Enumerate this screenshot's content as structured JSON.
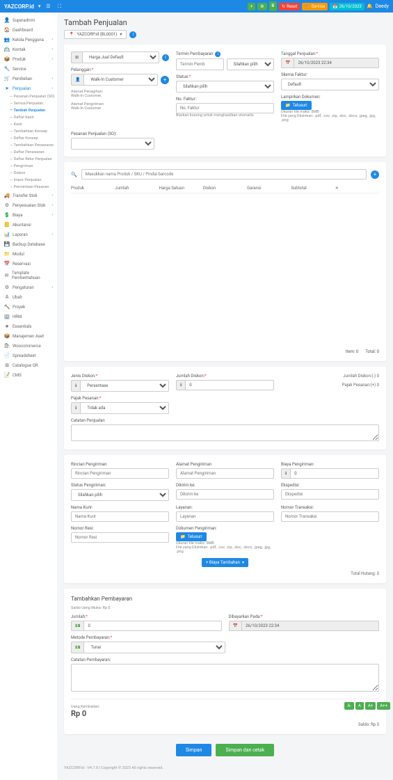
{
  "header": {
    "brand": "YAZCORP.id",
    "brand_sub": "▾",
    "reset": "Reset",
    "service": "Service",
    "date": "26/10/2023",
    "user": "Deedy"
  },
  "sidebar": {
    "items": [
      {
        "icon": "👤",
        "label": "Superadmin"
      },
      {
        "icon": "🏠",
        "label": "Dashboard"
      },
      {
        "icon": "👥",
        "label": "Kelola Pengguna",
        "chev": "‹"
      },
      {
        "icon": "📇",
        "label": "Kontak",
        "chev": "‹"
      },
      {
        "icon": "📦",
        "label": "Produk",
        "chev": "‹"
      },
      {
        "icon": "🔧",
        "label": "Service"
      },
      {
        "icon": "🛒",
        "label": "Pembelian",
        "chev": "‹"
      },
      {
        "icon": "➤",
        "label": "Penjualan",
        "chev": "‹",
        "active": true
      },
      {
        "icon": "🚚",
        "label": "Transfer Stok",
        "chev": "‹"
      },
      {
        "icon": "⚙",
        "label": "Penyesuaian Stok",
        "chev": "‹"
      },
      {
        "icon": "💲",
        "label": "Biaya",
        "chev": "‹"
      },
      {
        "icon": "📒",
        "label": "Akuntansi"
      },
      {
        "icon": "📊",
        "label": "Laporan",
        "chev": "‹"
      },
      {
        "icon": "💾",
        "label": "Backup Database"
      },
      {
        "icon": "📁",
        "label": "Modul"
      },
      {
        "icon": "📅",
        "label": "Reservasi"
      },
      {
        "icon": "✉",
        "label": "Template Pemberitahuan"
      },
      {
        "icon": "⚙",
        "label": "Pengaturan",
        "chev": "‹"
      },
      {
        "icon": "A",
        "label": "Ubah"
      },
      {
        "icon": "🔨",
        "label": "Proyek"
      },
      {
        "icon": "🏢",
        "label": "HRM"
      },
      {
        "icon": "★",
        "label": "Essentials"
      },
      {
        "icon": "📦",
        "label": "Manajemen Aset"
      },
      {
        "icon": "🛍",
        "label": "Woocommerce"
      },
      {
        "icon": "📄",
        "label": "Spreadsheet"
      },
      {
        "icon": "⊞",
        "label": "Catalogue QR"
      },
      {
        "icon": "📝",
        "label": "CMS"
      }
    ],
    "subs": [
      "Pesanan Penjualan (SO)",
      "Semua Penjualan",
      "Tambah Penjualan",
      "Daftar Kasir",
      "Kasir",
      "Tambahkan Konsep",
      "Daftar Konsep",
      "Tambahkan Penawaran",
      "Daftar Penawaran",
      "Daftar Retur Penjualan",
      "Pengiriman",
      "Diskon",
      "Impor Penjualan",
      "Permintaan Pesanan"
    ]
  },
  "page": {
    "title": "Tambah Penjualan"
  },
  "location": {
    "value": "YAZCORP.id (BL0001)"
  },
  "price_scheme": {
    "label": "Harga Jual Default"
  },
  "customer": {
    "label": "Pelanggan:",
    "value": "Walk-In Customer",
    "billing_label": "Alamat Penagihan:",
    "billing_value": "Walk-In Customer,",
    "shipping_label": "Alamat Pengiriman:",
    "shipping_value": "Walk-In Customer"
  },
  "so": {
    "label": "Pesanan Penjualan (SO):"
  },
  "payment_term": {
    "label": "Termin Pembayaran:",
    "placeholder1": "Termin Pemb",
    "value2": "Silahkan pilih"
  },
  "status": {
    "label": "Status:",
    "value": "Silahkan pilih"
  },
  "invoice": {
    "no_label": "No. Faktur:",
    "no_placeholder": "No. Faktur",
    "note": "Biarkan kosong untuk menghasilkan otomatis"
  },
  "sale_date": {
    "label": "Tanggal Penjualan:",
    "value": "26/10/2023 22:34"
  },
  "invoice_scheme": {
    "label": "Skema Faktur:",
    "value": "Default"
  },
  "attach": {
    "label": "Lampirkan Dokumen:",
    "btn": "Telusuri",
    "max": "Ukuran file maks: 5MB",
    "types": "File yang Diizinkan: .pdf, .csv, .zip, .doc, .docx, .jpeg, .jpg, .png"
  },
  "product_search": {
    "placeholder": "Masukkan nama Produk / SKU / Pindai barcode"
  },
  "table": {
    "headers": [
      "Produk",
      "Jumlah",
      "Harga Satuan",
      "Diskon",
      "Garansi",
      "Subtotal",
      "✕"
    ],
    "items_label": "Item:",
    "items_val": "0",
    "total_label": "Total:",
    "total_val": "0"
  },
  "discount": {
    "type_label": "Jenis Diskon:",
    "type_value": "Persentase",
    "amount_label": "Jumlah Diskon:",
    "amount_value": "0",
    "summary": "Jumlah Diskon:(-) 0"
  },
  "tax": {
    "label": "Pajak Pesanan:",
    "value": "Tidak ada",
    "summary": "Pajak Pesanan:(+) 0"
  },
  "sale_note": {
    "label": "Catatan Penjualan"
  },
  "shipping": {
    "detail_label": "Rincian Pengiriman",
    "detail_placeholder": "Rincian Pengiriman",
    "address_label": "Alamat Pengiriman",
    "address_placeholder": "Alamat Pengiriman",
    "cost_label": "Biaya Pengiriman:",
    "cost_value": "0",
    "status_label": "Status Pengiriman:",
    "status_value": "Silahkan pilih",
    "sendto_label": "Dikirim ke:",
    "sendto_placeholder": "Dikirim ke",
    "expedition_label": "Ekspedisi:",
    "expedition_placeholder": "Ekspedisi",
    "courier_label": "Nama Kurir:",
    "courier_placeholder": "Nama Kurir",
    "service_label": "Layanan:",
    "service_placeholder": "Layanan",
    "trx_label": "Nomor Transaksi:",
    "trx_placeholder": "Nomor Transaksi",
    "resi_label": "Nomor Resi:",
    "resi_placeholder": "Nomor Resi",
    "doc_label": "Dokumen Pengiriman:",
    "doc_btn": "Telusuri",
    "doc_max": "Ukuran file maks: 5MB",
    "doc_types": "File yang Diizinkan: .pdf, .csv, .zip, .doc, .docx, .jpeg, .jpg, .png",
    "extra_btn": "+ Biaya Tambahan ",
    "due_label": "Total Hutang:",
    "due_value": "0"
  },
  "payment": {
    "title": "Tambahkan Pembayaran",
    "advance": "Saldo Uang Muka: Rp 0",
    "amount_label": "Jumlah:",
    "amount_value": "0",
    "paid_label": "Dibayarkan Pada:",
    "paid_value": "26/10/2023 22:34",
    "method_label": "Metode Pembayaran:",
    "method_value": "Tunai",
    "note_label": "Catatan Pembayaran:",
    "change_label": "Uang Kembalian:",
    "change_value": "Rp 0",
    "balance": "Saldo: Rp 0"
  },
  "actions": {
    "save": "Simpan",
    "save_print": "Simpan dan cetak"
  },
  "footer": {
    "copyright": "YAZCORP.id - V4.7.8 | Copyright © 2023 All rights reserved."
  },
  "acc": [
    "A-",
    "A",
    "A+",
    "A++"
  ]
}
